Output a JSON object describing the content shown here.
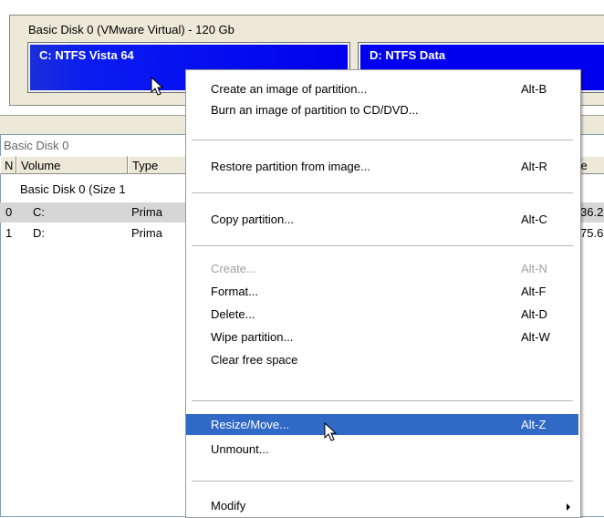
{
  "disk_map": {
    "title": "Basic Disk 0 (VMware Virtual) - 120 Gb",
    "partitions": [
      {
        "label": "C: NTFS Vista 64",
        "color": "#0000ee",
        "selected": true
      },
      {
        "label": "D: NTFS Data",
        "color": "#0000ee",
        "selected": false
      }
    ]
  },
  "volume_list": {
    "title": "Basic Disk 0",
    "columns": [
      "N",
      "Volume",
      "Type",
      "ree"
    ],
    "group": "Basic Disk 0 (Size 1",
    "rows": [
      {
        "n": "0",
        "volume": "C:",
        "type": "Prima",
        "free": "36.2",
        "selected": true
      },
      {
        "n": "1",
        "volume": "D:",
        "type": "Prima",
        "free": "75.6",
        "selected": false
      }
    ]
  },
  "context_menu": {
    "items": [
      {
        "label": "Create an image of partition...",
        "shortcut": "Alt-B",
        "enabled": true
      },
      {
        "label": "Burn an image of partition to CD/DVD...",
        "shortcut": "",
        "enabled": true
      },
      {
        "label": "Restore partition from image...",
        "shortcut": "Alt-R",
        "enabled": true
      },
      {
        "label": "Copy partition...",
        "shortcut": "Alt-C",
        "enabled": true
      },
      {
        "label": "Create...",
        "shortcut": "Alt-N",
        "enabled": false
      },
      {
        "label": "Format...",
        "shortcut": "Alt-F",
        "enabled": true
      },
      {
        "label": "Delete...",
        "shortcut": "Alt-D",
        "enabled": true
      },
      {
        "label": "Wipe partition...",
        "shortcut": "Alt-W",
        "enabled": true
      },
      {
        "label": "Clear free space",
        "shortcut": "",
        "enabled": true
      },
      {
        "label": "Resize/Move...",
        "shortcut": "Alt-Z",
        "enabled": true,
        "highlighted": true
      },
      {
        "label": "Unmount...",
        "shortcut": "",
        "enabled": true
      },
      {
        "label": "Modify",
        "shortcut": "",
        "enabled": true,
        "submenu": true
      }
    ]
  }
}
